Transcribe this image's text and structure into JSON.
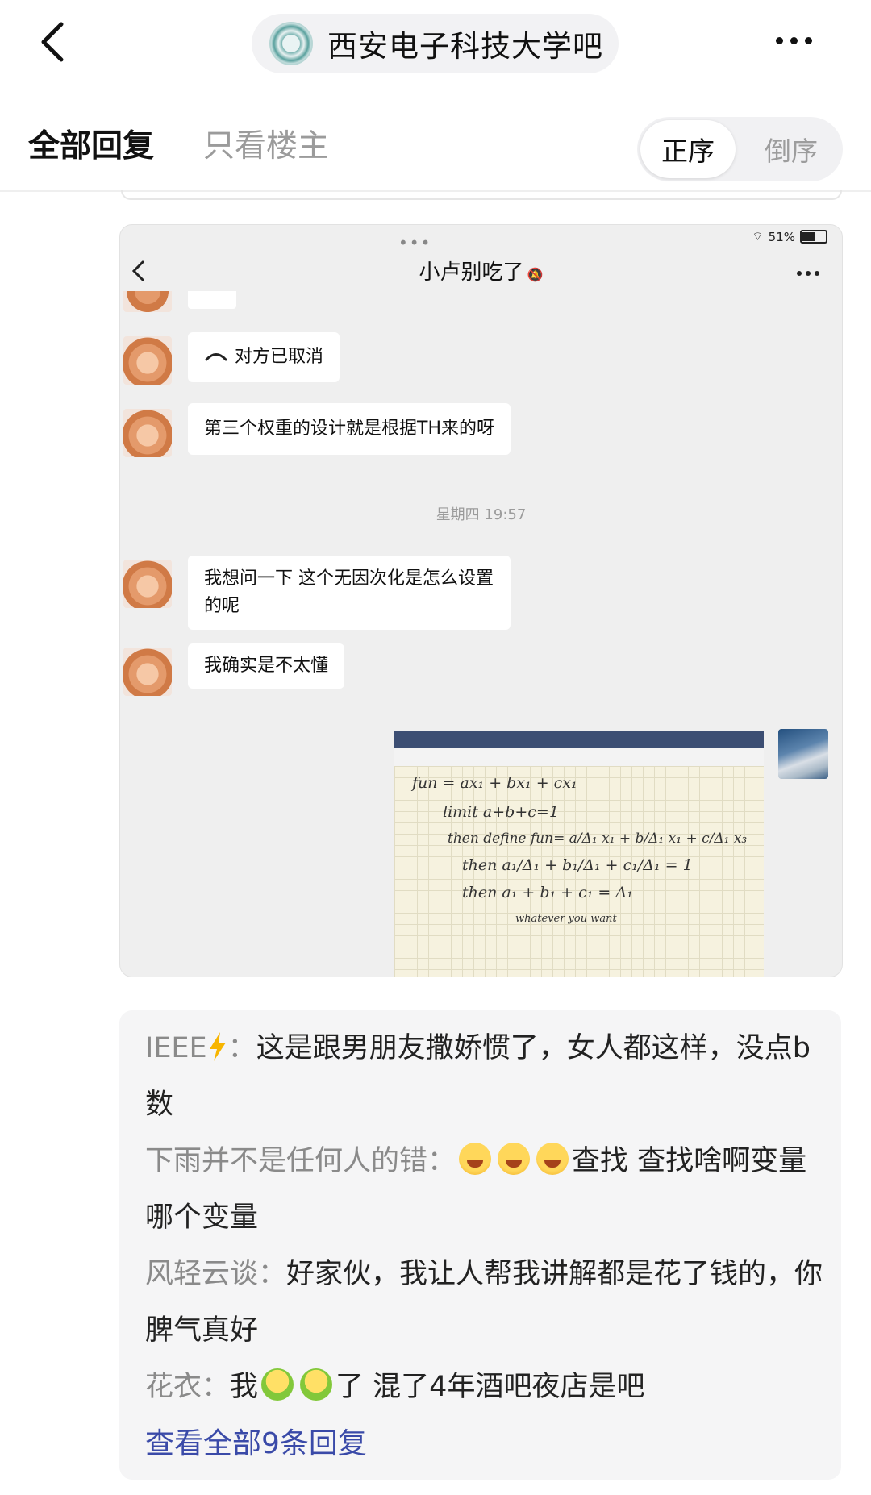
{
  "header": {
    "back_icon": "chevron-left-icon",
    "forum_name": "西安电子科技大学吧",
    "more_icon": "more-dots-icon"
  },
  "tabs": {
    "all_replies": "全部回复",
    "op_only": "只看楼主",
    "order_asc": "正序",
    "order_desc": "倒序"
  },
  "chat_screenshot": {
    "status": {
      "battery": "51%"
    },
    "title": "小卢别吃了",
    "messages": [
      {
        "text": "对方已取消"
      },
      {
        "text": "第三个权重的设计就是根据TH来的呀"
      },
      {
        "text": "我想问一下 这个无因次化是怎么设置的呢"
      },
      {
        "text": "我确实是不太懂"
      }
    ],
    "timestamp": "星期四 19:57",
    "note_lines": [
      "fun = ax₁ + bx₁ + cx₁",
      "limit   a+b+c=1",
      "then define  fun= a/Δ₁ x₁ + b/Δ₁ x₁ + c/Δ₁ x₃",
      "then   a₁/Δ₁ + b₁/Δ₁ + c₁/Δ₁ = 1",
      "then    a₁ + b₁ + c₁ = Δ₁",
      "whatever you want"
    ]
  },
  "replies": [
    {
      "user": "IEEE",
      "sep": "：",
      "text": "这是跟男朋友撒娇惯了，女人都这样，没点b数"
    },
    {
      "user": "下雨并不是任何人的错",
      "sep": "：",
      "text": "查找 查找啥啊变量 哪个变量"
    },
    {
      "user": "风轻云谈",
      "sep": "：",
      "text": "好家伙，我让人帮我讲解都是花了钱的，你脾气真好"
    },
    {
      "user": "花衣",
      "sep": "：",
      "pre": "我",
      "post": "了 混了4年酒吧夜店是吧"
    }
  ],
  "view_all": "查看全部9条回复",
  "colors": {
    "link": "#3a4aa8",
    "muted": "#8a8a8a",
    "panel_bg": "#f5f5f6"
  }
}
